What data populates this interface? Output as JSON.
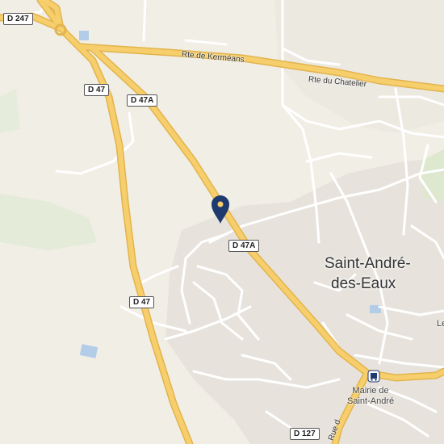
{
  "map": {
    "colors": {
      "land": "#f1eee5",
      "urban": "#e6e2db",
      "green": "#e3ecd5",
      "water": "#b3cde8",
      "major_road": "#f6cf6c",
      "major_road_casing": "#e3b34c",
      "minor_road": "#ffffff",
      "marker": "#1f3a6e"
    },
    "road_shields": {
      "d247": "D 247",
      "d47_top": "D 47",
      "d47a_top": "D 47A",
      "d47a_mid": "D 47A",
      "d47_bottom": "D 47",
      "d127": "D 127"
    },
    "road_labels": {
      "kermeans": "Rte de Kerméans",
      "chatelier": "Rte du Chatelier",
      "rue": "Rue d"
    },
    "town": {
      "line1": "Saint-André-",
      "line2": "des-Eaux"
    },
    "poi": {
      "mairie_line1": "Mairie de",
      "mairie_line2": "Saint-André",
      "edge_label": "Le",
      "mairie_icon": "bus-stop-icon"
    },
    "marker": {
      "icon": "location-pin-icon"
    }
  }
}
